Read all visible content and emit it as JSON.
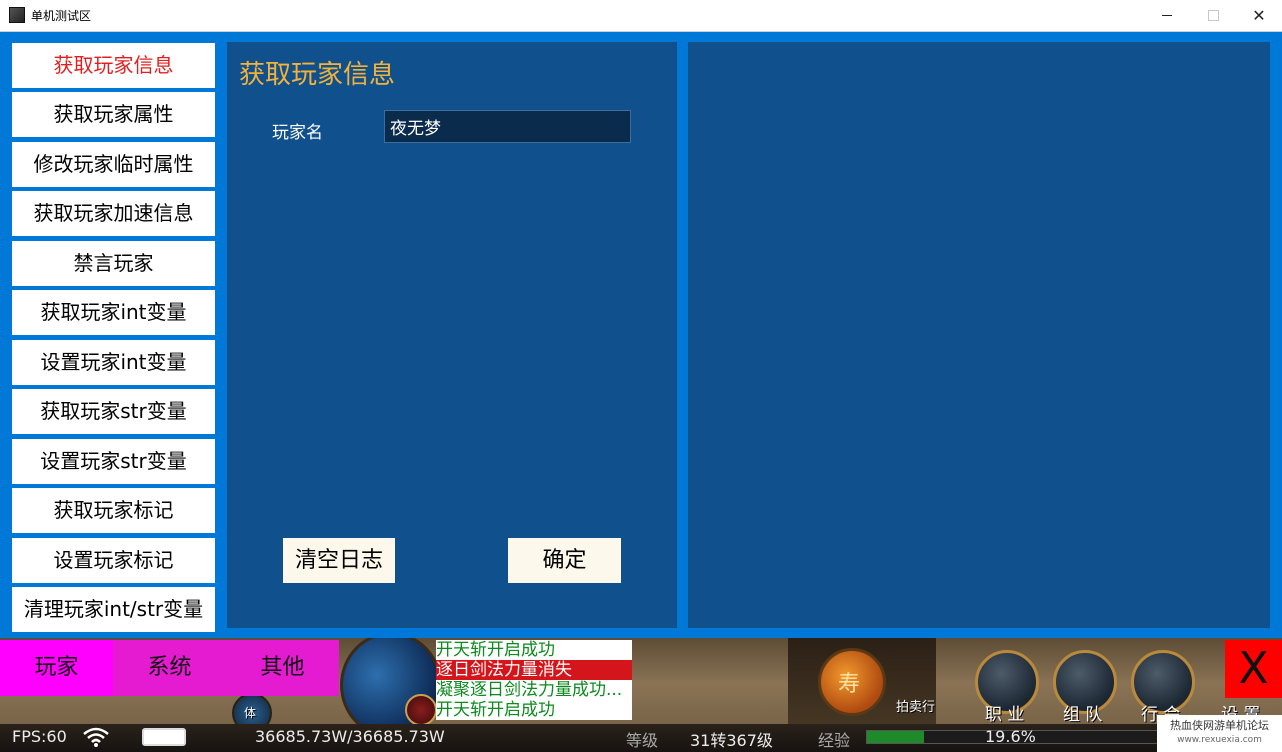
{
  "window": {
    "title": "单机测试区"
  },
  "sidebar": {
    "items": [
      {
        "label": "获取玩家信息"
      },
      {
        "label": "获取玩家属性"
      },
      {
        "label": "修改玩家临时属性"
      },
      {
        "label": "获取玩家加速信息"
      },
      {
        "label": "禁言玩家"
      },
      {
        "label": "获取玩家int变量"
      },
      {
        "label": "设置玩家int变量"
      },
      {
        "label": "获取玩家str变量"
      },
      {
        "label": "设置玩家str变量"
      },
      {
        "label": "获取玩家标记"
      },
      {
        "label": "设置玩家标记"
      },
      {
        "label": "清理玩家int/str变量"
      }
    ]
  },
  "main": {
    "title": "获取玩家信息",
    "player_name_label": "玩家名",
    "player_name_value": "夜无梦",
    "clear_log_label": "清空日志",
    "confirm_label": "确定"
  },
  "tabs": [
    {
      "label": "玩家"
    },
    {
      "label": "系统"
    },
    {
      "label": "其他"
    }
  ],
  "close_label": "X",
  "chat": {
    "lines": [
      {
        "text": "开天斩开启成功"
      },
      {
        "text": "逐日剑法力量消失"
      },
      {
        "text": "凝聚逐日剑法力量成功..."
      },
      {
        "text": "开天斩开启成功"
      }
    ]
  },
  "game_hud": {
    "auction_label": "拍卖行",
    "profession_label": "职 业",
    "team_label": "组 队",
    "guild_label": "行 会",
    "settings_label": "设 置",
    "coin_glyph": "寿",
    "orb_label": "体"
  },
  "status": {
    "fps": "FPS:60",
    "hp": "36685.73W/36685.73W",
    "level_label": "等级",
    "level_value": "31转367级",
    "exp_label": "经验",
    "exp_percent": "19.6%",
    "exp_fraction": 0.196
  },
  "watermark": {
    "line1": "热血侠网游单机论坛",
    "line2": "www.rexuexia.com"
  },
  "colors": {
    "accent_blue": "#0078d7",
    "panel": "#10508c",
    "title_gold": "#f4b23a",
    "tab_magenta": "#e51bd1",
    "active_red": "#e02020"
  }
}
